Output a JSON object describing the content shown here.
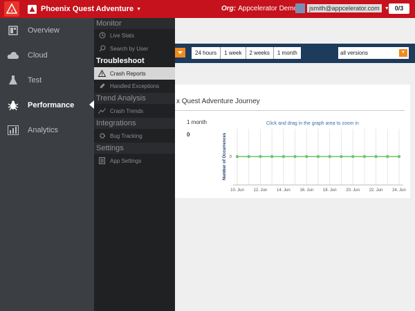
{
  "header": {
    "app_name": "Phoenix Quest Adventure",
    "org_label": "Org:",
    "org_name": "Appcelerator Demo",
    "user_email": "jsmith@appcelerator.com",
    "counter": "0/3"
  },
  "sidebar": {
    "items": [
      {
        "label": "Overview",
        "icon": "overview-icon"
      },
      {
        "label": "Cloud",
        "icon": "cloud-icon"
      },
      {
        "label": "Test",
        "icon": "flask-icon"
      },
      {
        "label": "Performance",
        "icon": "bug-icon"
      },
      {
        "label": "Analytics",
        "icon": "bar-chart-icon"
      }
    ]
  },
  "flyout": {
    "monitor": "Monitor",
    "live_stats": "Live Stats",
    "search_by_user": "Search by User",
    "troubleshoot": "Troubleshoot",
    "crash_reports": "Crash Reports",
    "handled_exceptions": "Handled Exceptions",
    "trend_analysis": "Trend Analysis",
    "crash_trends": "Crash Trends",
    "integrations": "Integrations",
    "bug_tracking": "Bug Tracking",
    "settings": "Settings",
    "app_settings": "App Settings"
  },
  "toolbar": {
    "ranges": [
      "24 hours",
      "1 week",
      "2 weeks",
      "1 month"
    ],
    "version_select": "all versions"
  },
  "card": {
    "title": "x Quest Adventure Journey",
    "metric_label": "1 month",
    "metric_value": "0",
    "hint": "Click and drag in the graph area to zoom in"
  },
  "chart_data": {
    "type": "line",
    "ylabel": "Number of Occurrences",
    "xlabel": "",
    "x_ticks": [
      "10. Jun",
      "12. Jun",
      "14. Jun",
      "16. Jun",
      "18. Jun",
      "20. Jun",
      "22. Jun",
      "24. Jun"
    ],
    "x": [
      "10. Jun",
      "11. Jun",
      "12. Jun",
      "13. Jun",
      "14. Jun",
      "15. Jun",
      "16. Jun",
      "17. Jun",
      "18. Jun",
      "19. Jun",
      "20. Jun",
      "21. Jun",
      "22. Jun",
      "23. Jun",
      "24. Jun"
    ],
    "values": [
      0,
      0,
      0,
      0,
      0,
      0,
      0,
      0,
      0,
      0,
      0,
      0,
      0,
      0,
      0
    ],
    "y_ticks": [
      "0"
    ],
    "color": "#6cc46c",
    "grid": true
  }
}
